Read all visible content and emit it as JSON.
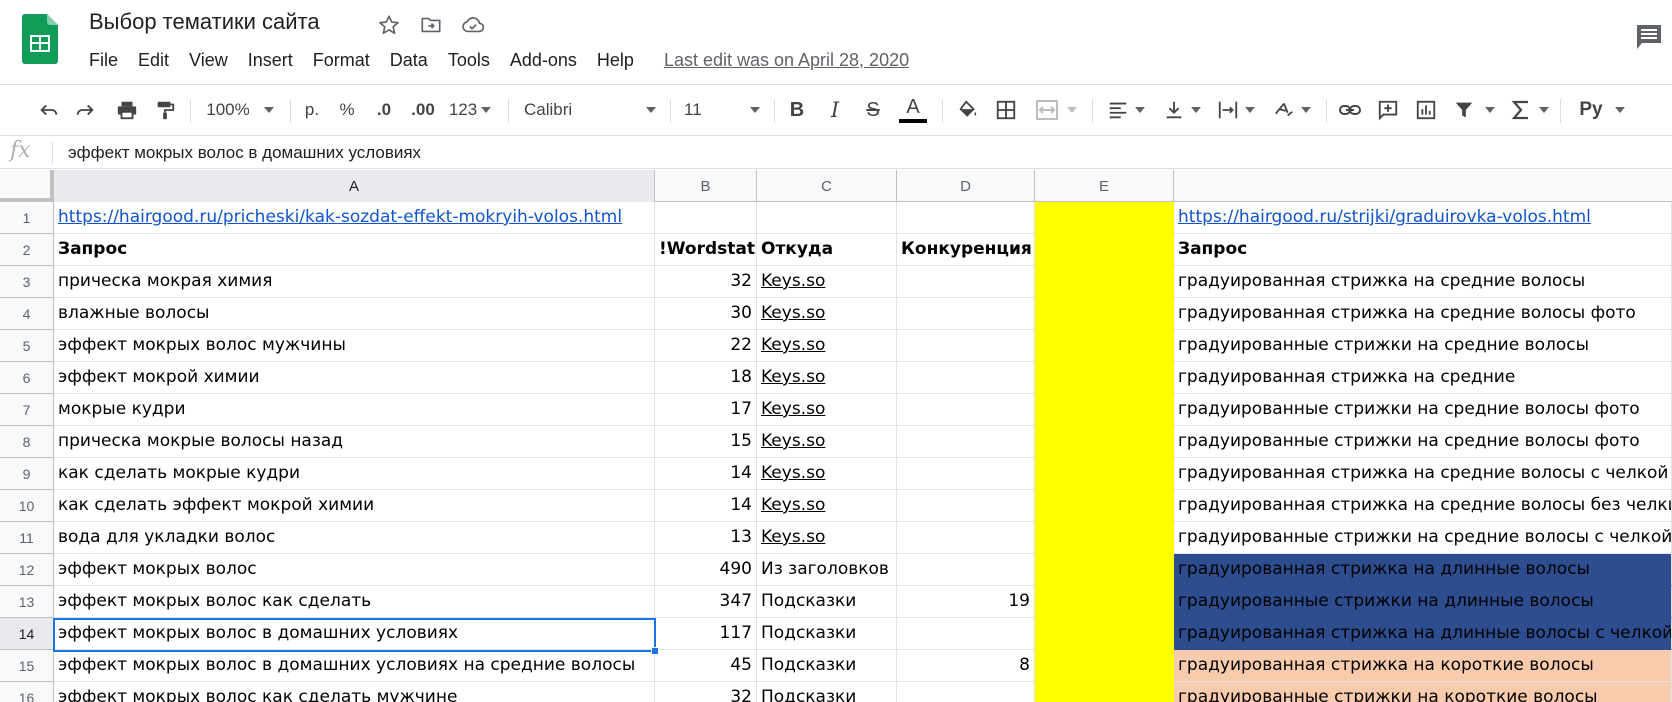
{
  "document": {
    "title": "Выбор тематики сайта",
    "last_edit": "Last edit was on April 28, 2020"
  },
  "menu": [
    "File",
    "Edit",
    "View",
    "Insert",
    "Format",
    "Data",
    "Tools",
    "Add-ons",
    "Help"
  ],
  "toolbar": {
    "zoom": "100%",
    "currency": "р.",
    "percent": "%",
    "decrease_decimals": ".0",
    "increase_decimals": ".00",
    "more_formats": "123",
    "font": "Calibri",
    "font_size": "11",
    "bold": "B",
    "italic": "I",
    "strikethrough": "S",
    "text_color": "A",
    "text_color_value": "#000000",
    "input_tools": "Pу"
  },
  "formula_bar": {
    "fx_label": "fx",
    "value": "эффект мокрых волос в домашних условиях"
  },
  "columns": [
    "A",
    "B",
    "C",
    "D",
    "E",
    ""
  ],
  "colors": {
    "yellow": "#ffff00",
    "blue": "#2e4d8f",
    "peach": "#f9cbad",
    "link": "#1155cc",
    "selection": "#1a73e8"
  },
  "rows": [
    {
      "n": "1",
      "a": "https://hairgood.ru/pricheski/kak-sozdat-effekt-mokryih-volos.html",
      "b": "",
      "c": "",
      "d": "",
      "f": "https://hairgood.ru/strijki/graduirovka-volos.html"
    },
    {
      "n": "2",
      "a": "Запрос",
      "b": "!Wordstat",
      "c": "Откуда",
      "d": "Конкуренция",
      "f": "Запрос"
    },
    {
      "n": "3",
      "a": "прическа мокрая химия",
      "b": "32",
      "c": "Keys.so",
      "d": "",
      "f": "градуированная стрижка на средние волосы"
    },
    {
      "n": "4",
      "a": "влажные волосы",
      "b": "30",
      "c": "Keys.so",
      "d": "",
      "f": "градуированная стрижка на средние волосы фото"
    },
    {
      "n": "5",
      "a": "эффект мокрых волос мужчины",
      "b": "22",
      "c": "Keys.so",
      "d": "",
      "f": "градуированные стрижки на средние волосы"
    },
    {
      "n": "6",
      "a": "эффект мокрой химии",
      "b": "18",
      "c": "Keys.so",
      "d": "",
      "f": "градуированная стрижка на средние"
    },
    {
      "n": "7",
      "a": "мокрые кудри",
      "b": "17",
      "c": "Keys.so",
      "d": "",
      "f": "градуированные стрижки на средние волосы фото"
    },
    {
      "n": "8",
      "a": "прическа мокрые волосы назад",
      "b": "15",
      "c": "Keys.so",
      "d": "",
      "f": "градуированные стрижки на средние волосы фото"
    },
    {
      "n": "9",
      "a": "как сделать мокрые кудри",
      "b": "14",
      "c": "Keys.so",
      "d": "",
      "f": "градуированная стрижка на средние волосы с челкой фото"
    },
    {
      "n": "10",
      "a": "как сделать эффект мокрой химии",
      "b": "14",
      "c": "Keys.so",
      "d": "",
      "f": "градуированная стрижка на средние волосы без челки"
    },
    {
      "n": "11",
      "a": "вода для укладки волос",
      "b": "13",
      "c": "Keys.so",
      "d": "",
      "f": "градуированные стрижки на средние волосы с челкой"
    },
    {
      "n": "12",
      "a": "эффект мокрых волос",
      "b": "490",
      "c": "Из заголовков",
      "d": "",
      "f": "градуированная стрижка на длинные волосы"
    },
    {
      "n": "13",
      "a": "эффект мокрых волос как сделать",
      "b": "347",
      "c": "Подсказки",
      "d": "19",
      "f": "градуированные стрижки на длинные волосы"
    },
    {
      "n": "14",
      "a": "эффект мокрых волос в домашних условиях",
      "b": "117",
      "c": "Подсказки",
      "d": "",
      "f": "градуированная стрижка на длинные волосы с челкой"
    },
    {
      "n": "15",
      "a": "эффект мокрых волос в домашних условиях на средние волосы",
      "b": "45",
      "c": "Подсказки",
      "d": "8",
      "f": "градуированная стрижка на короткие волосы"
    },
    {
      "n": "16",
      "a": "эффект мокрых волос как сделать мужчине",
      "b": "32",
      "c": "Подсказки",
      "d": "",
      "f": "градуированные стрижки на короткие волосы"
    }
  ]
}
